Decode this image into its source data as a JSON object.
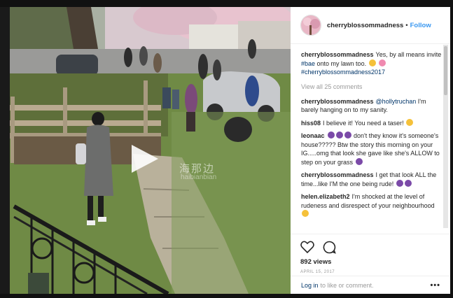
{
  "media": {
    "watermark": "海那边",
    "watermark_sub": "haibianbian"
  },
  "header": {
    "username": "cherryblossommadness",
    "separator": "•",
    "follow_label": "Follow"
  },
  "comments": [
    {
      "user": "cherryblossommadness",
      "segments": [
        {
          "t": "Yes, by all means invite "
        },
        {
          "tag": "#bae"
        },
        {
          "t": " onto my lawn too. "
        }
      ],
      "emoji": [
        "emo-sad",
        "emo-flower"
      ],
      "tail": [
        {
          "tag": "#cherryblossommadness2017"
        }
      ]
    }
  ],
  "view_all": "View all 25 comments",
  "thread": [
    {
      "user": "cherryblossommadness",
      "mention": "@hollytruchan",
      "text": " I'm barely hanging on to my sanity.",
      "emoji_after": []
    },
    {
      "user": "hiss08",
      "text": "I believe it! You need a taser! ",
      "emoji_after": [
        "emo-laugh"
      ]
    },
    {
      "user": "leonaac",
      "emoji_before": [
        "emo-woman",
        "emo-woman",
        "emo-woman"
      ],
      "text": " don't they know it's someone's house????? Btw the story this morning on your IG.....omg that look she gave like she's ALLOW to step on your grass ",
      "emoji_after": [
        "emo-woman"
      ]
    },
    {
      "user": "cherryblossommadness",
      "text": "I get that look ALL the time...like I'M the one being rude! ",
      "emoji_after": [
        "emo-woman",
        "emo-woman"
      ]
    },
    {
      "user": "helen.elizabeth2",
      "text": "I'm shocked at the level of rudeness and disrespect of your neighbourhood ",
      "emoji_after": [
        "emo-face"
      ]
    }
  ],
  "stats": {
    "views": "892 views",
    "date": "APRIL 15, 2017"
  },
  "footer": {
    "login_label": "Log in",
    "rest_label": "to like or comment.",
    "more_label": "•••"
  }
}
